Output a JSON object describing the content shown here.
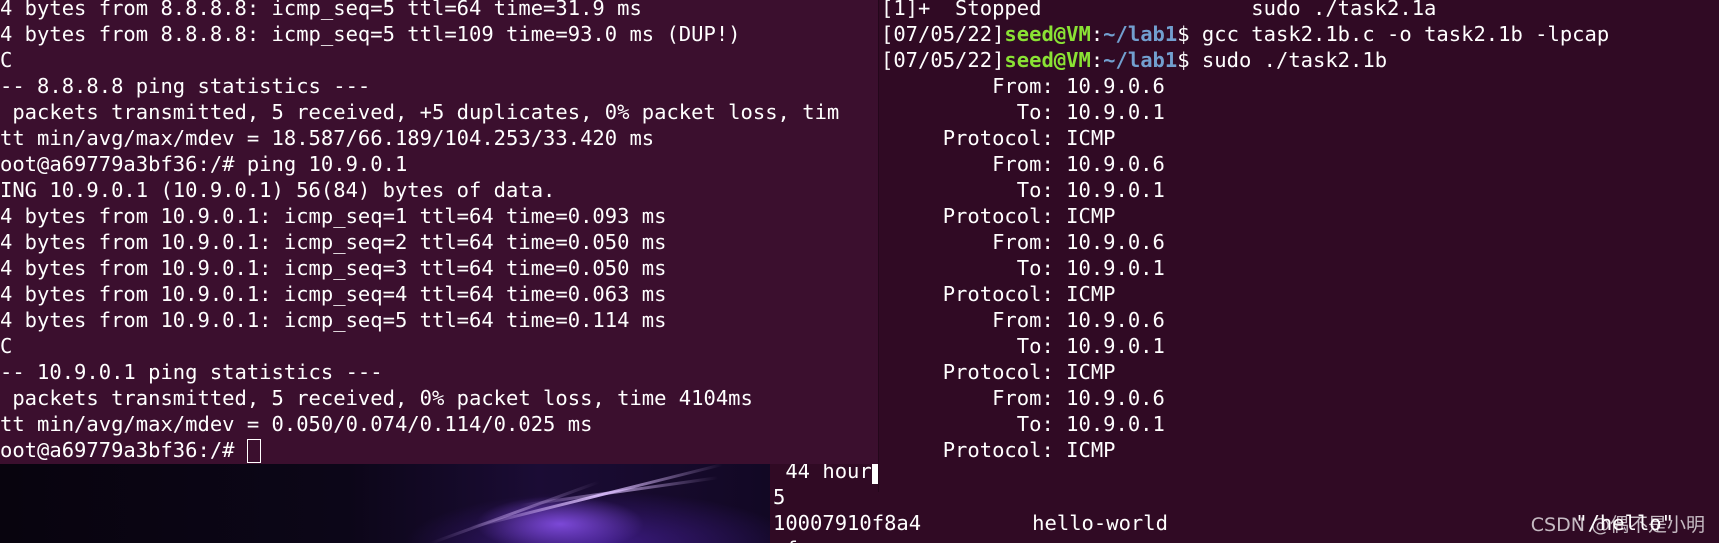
{
  "left_terminal": {
    "lines": [
      "4 bytes from 8.8.8.8: icmp_seq=5 ttl=64 time=31.9 ms",
      "4 bytes from 8.8.8.8: icmp_seq=5 ttl=109 time=93.0 ms (DUP!)",
      "C",
      "-- 8.8.8.8 ping statistics ---",
      " packets transmitted, 5 received, +5 duplicates, 0% packet loss, tim",
      "tt min/avg/max/mdev = 18.587/66.189/104.253/33.420 ms",
      "oot@a69779a3bf36:/# ping 10.9.0.1",
      "ING 10.9.0.1 (10.9.0.1) 56(84) bytes of data.",
      "4 bytes from 10.9.0.1: icmp_seq=1 ttl=64 time=0.093 ms",
      "4 bytes from 10.9.0.1: icmp_seq=2 ttl=64 time=0.050 ms",
      "4 bytes from 10.9.0.1: icmp_seq=3 ttl=64 time=0.050 ms",
      "4 bytes from 10.9.0.1: icmp_seq=4 ttl=64 time=0.063 ms",
      "4 bytes from 10.9.0.1: icmp_seq=5 ttl=64 time=0.114 ms",
      "C",
      "-- 10.9.0.1 ping statistics ---",
      " packets transmitted, 5 received, 0% packet loss, time 4104ms",
      "tt min/avg/max/mdev = 0.050/0.074/0.114/0.025 ms"
    ],
    "prompt": "oot@a69779a3bf36:/# "
  },
  "right_terminal": {
    "job_line": "[1]+  Stopped                 sudo ./task2.1a",
    "commands": [
      {
        "timestamp": "[07/05/22]",
        "user": "seed@VM",
        "sep": ":",
        "path": "~/lab1",
        "symbol": "$",
        "command": " gcc task2.1b.c -o task2.1b -lpcap"
      },
      {
        "timestamp": "[07/05/22]",
        "user": "seed@VM",
        "sep": ":",
        "path": "~/lab1",
        "symbol": "$",
        "command": " sudo ./task2.1b"
      }
    ],
    "output": [
      "         From: 10.9.0.6",
      "           To: 10.9.0.1",
      "     Protocol: ICMP",
      "         From: 10.9.0.6",
      "           To: 10.9.0.1",
      "     Protocol: ICMP",
      "         From: 10.9.0.6",
      "           To: 10.9.0.1",
      "     Protocol: ICMP",
      "         From: 10.9.0.6",
      "           To: 10.9.0.1",
      "     Protocol: ICMP",
      "         From: 10.9.0.6",
      "           To: 10.9.0.1",
      "     Protocol: ICMP"
    ]
  },
  "back_terminal": {
    "lines": [
      " 44 hour",
      "5",
      "10007910f8a4         hello-world                                 \"/hello\"",
      "af"
    ]
  },
  "watermark": "CSDN @偶不是小明",
  "colors": {
    "left_bg": "#3b0f2e",
    "right_bg": "#300a24",
    "prompt_user": "#8ae234",
    "prompt_path": "#729fcf"
  }
}
